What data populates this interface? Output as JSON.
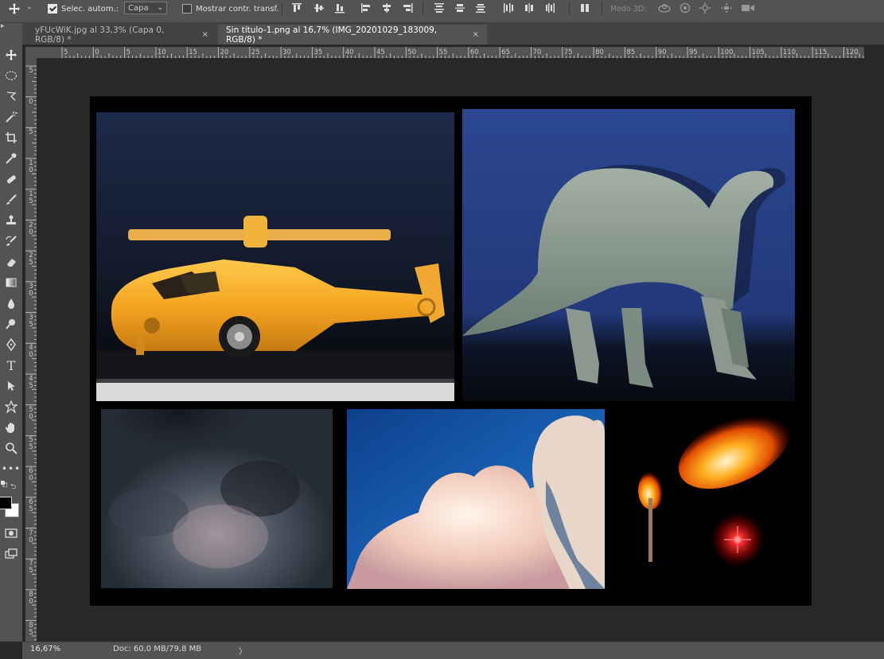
{
  "options_bar": {
    "auto_select_label": "Selec. autom.:",
    "auto_select_checked": true,
    "layer_select_value": "Capa",
    "show_transform_label": "Mostrar contr. transf.",
    "show_transform_checked": false,
    "mode_3d_label": "Modo 3D:"
  },
  "tabs": [
    {
      "label": "yFUcWiK.jpg al 33,3% (Capa 0, RGB/8) *",
      "close": "×",
      "active": false
    },
    {
      "label": "Sin título-1.png al 16,7% (IMG_20201029_183009, RGB/8) *",
      "close": "×",
      "active": true
    }
  ],
  "ruler_top": [
    "5",
    "0",
    "5",
    "10",
    "15",
    "20",
    "25",
    "30",
    "35",
    "40",
    "45",
    "50",
    "55",
    "60",
    "65",
    "70",
    "75",
    "80",
    "85",
    "90",
    "95",
    "100",
    "105",
    "110",
    "115",
    "120"
  ],
  "ruler_left": [
    [
      "5"
    ],
    [
      "0"
    ],
    [
      "5"
    ],
    [
      "1",
      "0"
    ],
    [
      "1",
      "5"
    ],
    [
      "2",
      "0"
    ],
    [
      "2",
      "5"
    ],
    [
      "3",
      "0"
    ],
    [
      "3",
      "5"
    ],
    [
      "4",
      "0"
    ],
    [
      "4",
      "5"
    ],
    [
      "5",
      "0"
    ],
    [
      "5",
      "5"
    ],
    [
      "6",
      "0"
    ],
    [
      "6",
      "5"
    ],
    [
      "7",
      "0"
    ],
    [
      "7",
      "5"
    ],
    [
      "8",
      "0"
    ],
    [
      "8",
      "5"
    ]
  ],
  "status": {
    "zoom": "16,67%",
    "doc_size": "Doc: 60,0 MB/79,8 MB",
    "arrow": "〉"
  },
  "colors": {
    "foreground": "#000000",
    "background": "#ffffff",
    "panel": "#535353",
    "workspace": "#282828"
  },
  "canvas_photos": [
    {
      "subject": "helicopter-toy-photo"
    },
    {
      "subject": "dinosaur-toy-photo"
    },
    {
      "subject": "dark-cloud-photo"
    },
    {
      "subject": "sky-clouds-photo"
    },
    {
      "subject": "fire-effects-photo"
    }
  ]
}
